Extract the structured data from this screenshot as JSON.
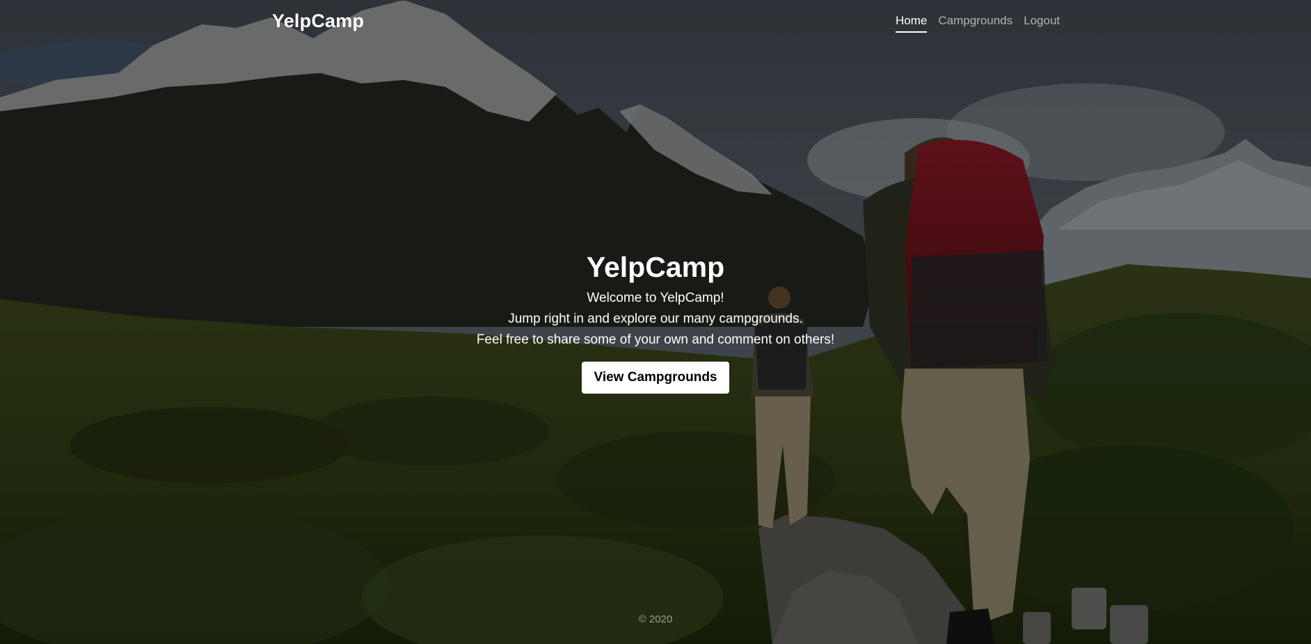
{
  "nav": {
    "brand": "YelpCamp",
    "links": [
      {
        "label": "Home",
        "active": true
      },
      {
        "label": "Campgrounds",
        "active": false
      },
      {
        "label": "Logout",
        "active": false
      }
    ]
  },
  "hero": {
    "title": "YelpCamp",
    "lines": [
      "Welcome to YelpCamp!",
      "Jump right in and explore our many campgrounds.",
      "Feel free to share some of your own and comment on others!"
    ],
    "button_label": "View Campgrounds"
  },
  "footer": {
    "text": "© 2020"
  },
  "colors": {
    "overlay": "#000000",
    "button_bg": "#ffffff",
    "button_text": "#000000"
  }
}
